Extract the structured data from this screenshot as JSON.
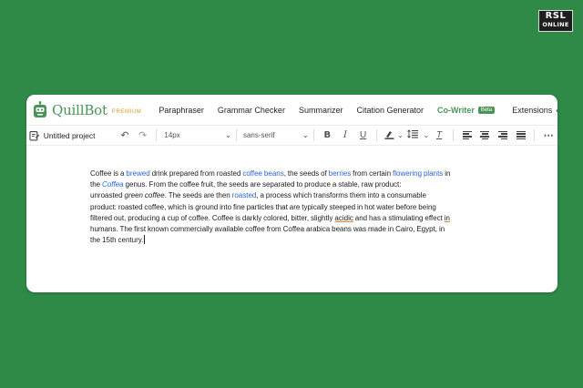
{
  "watermark": {
    "line1": "RSL",
    "line2": "ONLINE"
  },
  "brand": {
    "name": "QuillBot",
    "tier": "PREMIUM",
    "accent": "#499557",
    "background": "#2f8a47"
  },
  "nav": {
    "items": [
      "Paraphraser",
      "Grammar Checker",
      "Summarizer",
      "Citation Generator"
    ],
    "active": "Co-Writer",
    "badge": "Beta",
    "extensions": "Extensions"
  },
  "toolbar": {
    "project_title": "Untitled project",
    "font_size": "14px",
    "font_family": "sans-serif",
    "icons": [
      "undo-icon",
      "redo-icon",
      "bold-icon",
      "italic-icon",
      "underline-icon",
      "highlight-icon",
      "line-height-icon",
      "clear-format-icon",
      "align-left-icon",
      "align-center-icon",
      "align-right-icon",
      "align-justify-icon",
      "more-icon"
    ]
  },
  "document": {
    "l1": {
      "a": "Coffee is a ",
      "b": "brewed",
      "c": " drink prepared from roasted ",
      "d": "coffee beans",
      "e": ", the seeds of ",
      "f": "berries",
      "g": " from certain ",
      "h": "flowering plants",
      "i": " in"
    },
    "l2": {
      "a": "the ",
      "b": "Coffea",
      "c": " genus. From the coffee fruit, the seeds are separated to produce a stable, raw product:"
    },
    "l3": {
      "a": "unroasted ",
      "b": "green coffee",
      "c": ". The seeds are then ",
      "d": "roasted",
      "e": ", a process which transforms them into a consumable"
    },
    "l4": "product: roasted coffee, which is ground into fine particles that are typically steeped in hot water before being",
    "l5": {
      "a": "filtered out, producing a cup of coffee. Coffee is darkly colored, bitter, slightly ",
      "b": "acidic",
      "c": " and has a stimulating effect ",
      "d": "in"
    },
    "l6": "humans. The first known commercially available coffee from Coffea arabica beans was made in Cairo, Egypt, in",
    "l7": "the 15th century."
  }
}
